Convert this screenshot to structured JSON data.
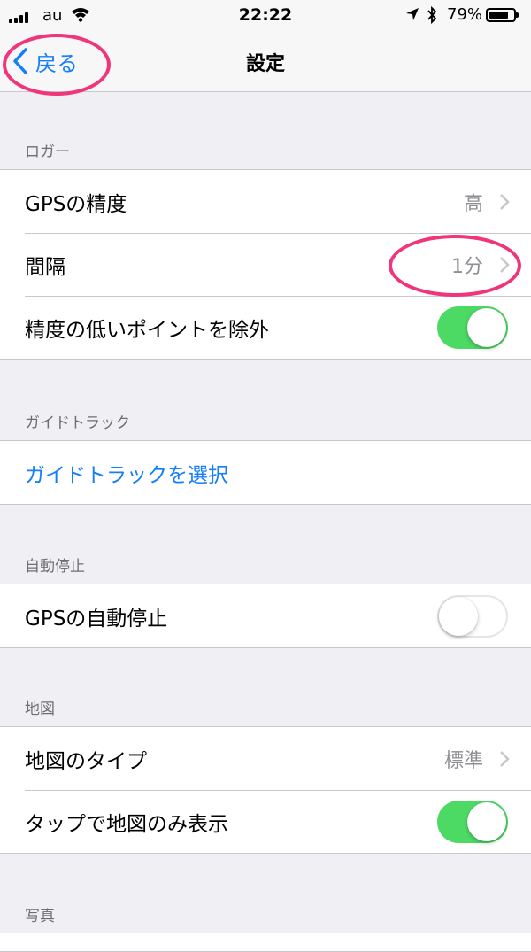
{
  "status": {
    "carrier": "au",
    "time": "22:22",
    "battery": "79%",
    "battery_level": 0.79
  },
  "nav": {
    "back_label": "戻る",
    "title": "設定"
  },
  "sections": {
    "logger": {
      "header": "ロガー",
      "gps_accuracy": {
        "label": "GPSの精度",
        "value": "高"
      },
      "interval": {
        "label": "間隔",
        "value": "1分"
      },
      "exclude_low": {
        "label": "精度の低いポイントを除外",
        "on": true
      }
    },
    "guide": {
      "header": "ガイドトラック",
      "select_label": "ガイドトラックを選択"
    },
    "auto_stop": {
      "header": "自動停止",
      "gps_auto_stop": {
        "label": "GPSの自動停止",
        "on": false
      }
    },
    "map": {
      "header": "地図",
      "map_type": {
        "label": "地図のタイプ",
        "value": "標準"
      },
      "tap_map_only": {
        "label": "タップで地図のみ表示",
        "on": true
      }
    },
    "photo": {
      "header": "写真"
    }
  },
  "colors": {
    "accent": "#157efb",
    "switch_on": "#4cd964",
    "annotation": "#f0357a",
    "background": "#efeff4"
  }
}
